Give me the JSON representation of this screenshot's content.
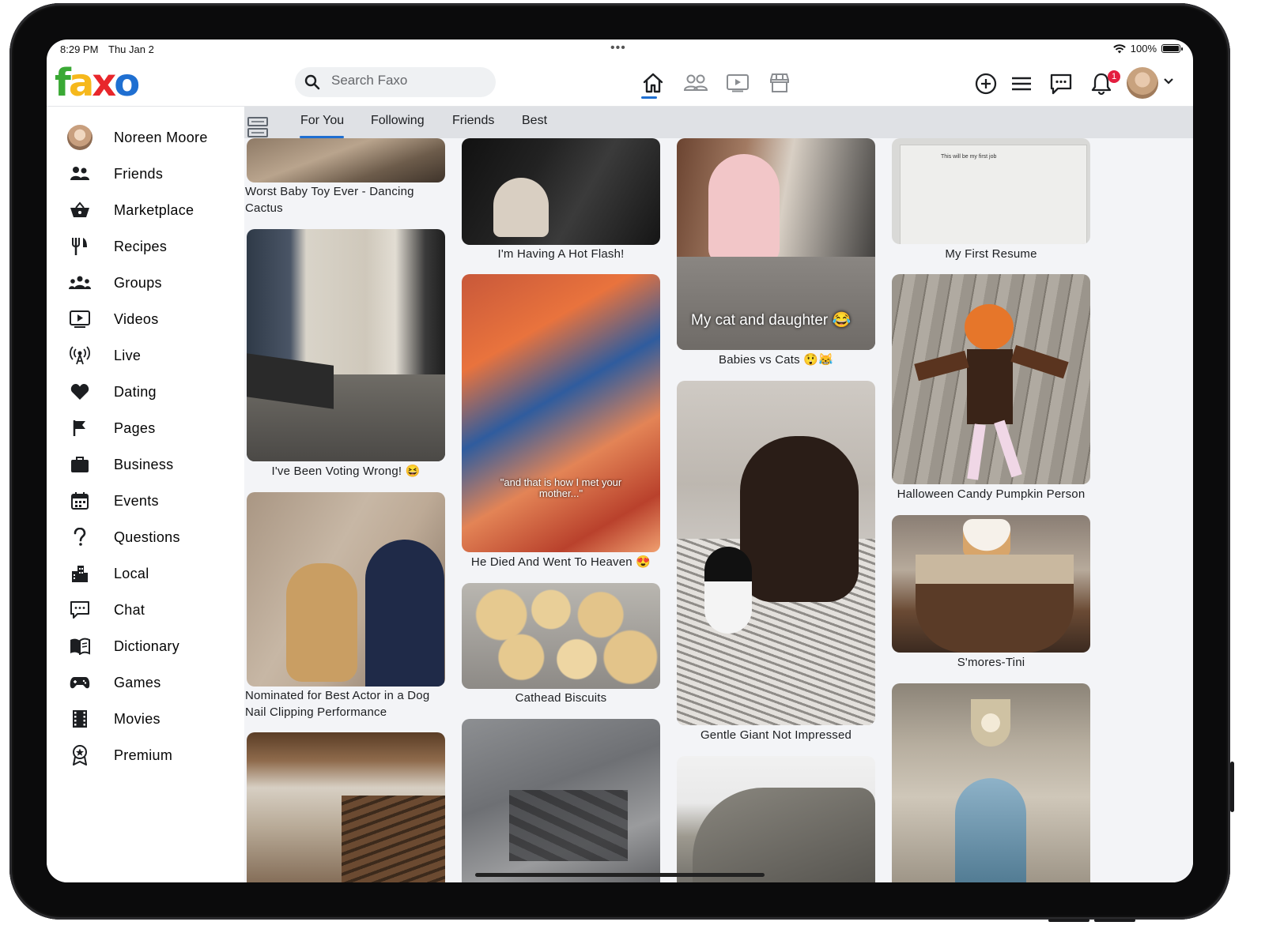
{
  "status_bar": {
    "time": "8:29 PM",
    "date": "Thu Jan 2",
    "dots": "•••",
    "battery": "100%",
    "battery_level": 1.0
  },
  "app": {
    "logo": "faxo",
    "logo_letters": [
      "f",
      "a",
      "x",
      "o"
    ],
    "logo_colors": [
      "#3aa935",
      "#f6b81c",
      "#e8262b",
      "#1f6fd1"
    ]
  },
  "search": {
    "placeholder": "Search Faxo",
    "value": ""
  },
  "topnav": {
    "center_icons": [
      "home-icon",
      "friends-icon",
      "watch-icon",
      "marketplace-icon"
    ],
    "active": "home-icon",
    "right_icons": [
      "create-icon",
      "menu-icon",
      "messenger-icon",
      "notifications-icon"
    ],
    "notification_count": "1"
  },
  "sidebar": {
    "items": [
      {
        "label": "Noreen Moore",
        "icon": "profile-avatar"
      },
      {
        "label": "Friends",
        "icon": "friends-icon"
      },
      {
        "label": "Marketplace",
        "icon": "basket-icon"
      },
      {
        "label": "Recipes",
        "icon": "utensils-icon"
      },
      {
        "label": "Groups",
        "icon": "groups-icon"
      },
      {
        "label": "Videos",
        "icon": "video-icon"
      },
      {
        "label": "Live",
        "icon": "live-icon"
      },
      {
        "label": "Dating",
        "icon": "heart-icon"
      },
      {
        "label": "Pages",
        "icon": "flag-icon"
      },
      {
        "label": "Business",
        "icon": "briefcase-icon"
      },
      {
        "label": "Events",
        "icon": "calendar-icon"
      },
      {
        "label": "Questions",
        "icon": "question-icon"
      },
      {
        "label": "Local",
        "icon": "buildings-icon"
      },
      {
        "label": "Chat",
        "icon": "chat-icon"
      },
      {
        "label": "Dictionary",
        "icon": "book-icon"
      },
      {
        "label": "Games",
        "icon": "gamepad-icon"
      },
      {
        "label": "Movies",
        "icon": "film-icon"
      },
      {
        "label": "Premium",
        "icon": "award-icon"
      }
    ]
  },
  "feed": {
    "tabs": [
      "For You",
      "Following",
      "Friends",
      "Best"
    ],
    "active_tab": "For You",
    "columns": [
      [
        {
          "caption": "Worst Baby Toy Ever - Dancing Cactus"
        },
        {
          "caption": "I've Been Voting Wrong! 😆"
        },
        {
          "caption": "Nominated for Best Actor in a Dog Nail Clipping Performance"
        },
        {
          "caption": ""
        }
      ],
      [
        {
          "caption": "I'm Having A Hot Flash!"
        },
        {
          "caption": "He Died And Went To Heaven 😍",
          "overlay": "\"and that is how I met your mother...\""
        },
        {
          "caption": "Cathead Biscuits"
        },
        {
          "caption": ""
        }
      ],
      [
        {
          "caption": "Babies vs Cats 😲😹",
          "overlay": "My cat and daughter 😂"
        },
        {
          "caption": "Gentle Giant Not Impressed"
        },
        {
          "caption": ""
        }
      ],
      [
        {
          "caption": "My First Resume",
          "overlay": "This will be my first job"
        },
        {
          "caption": "Halloween Candy Pumpkin Person"
        },
        {
          "caption": "S'mores-Tini"
        },
        {
          "caption": ""
        }
      ]
    ]
  }
}
